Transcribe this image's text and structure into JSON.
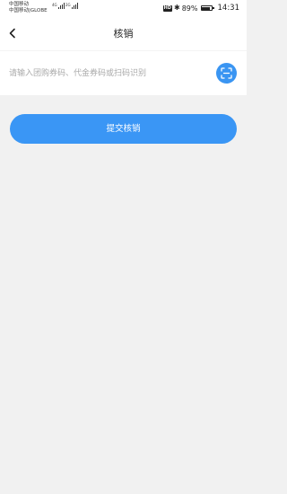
{
  "status_bar": {
    "carrier_1": "中国移动",
    "carrier_2": "中国移动|GLOBE",
    "signal_1_tag": "4G",
    "signal_2_tag": "2G",
    "hd_label": "HD",
    "bluetooth": "✱",
    "battery_percent": "89%",
    "battery_level": 0.89,
    "time": "14:31"
  },
  "nav": {
    "back_icon": "chevron-left-icon",
    "title": "核销"
  },
  "code_input": {
    "value": "",
    "placeholder": "请输入团购券码、代金券码或扫码识别",
    "scan_icon": "scan-icon"
  },
  "submit": {
    "label": "提交核销"
  },
  "colors": {
    "accent": "#3a96f5",
    "background": "#f1f1f1",
    "surface": "#ffffff",
    "placeholder": "#aaaaaa"
  }
}
